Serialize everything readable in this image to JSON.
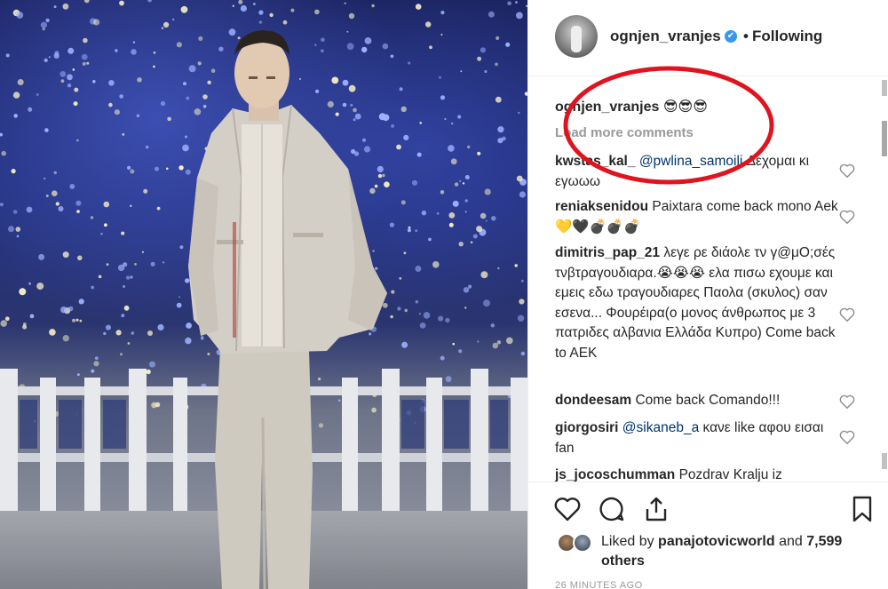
{
  "header": {
    "username": "ognjen_vranjes",
    "verified_badge": "✔",
    "separator": "•",
    "follow_status": "Following"
  },
  "caption": {
    "username": "ognjen_vranjes",
    "text": "😎😎😎"
  },
  "load_more": "Load more comments",
  "comments": [
    {
      "user": "kwstas_kal_",
      "mention": "@pwlina_samoili",
      "text": " Δεχομαι κι εγωωω"
    },
    {
      "user": "reniaksenidou",
      "mention": "",
      "text": "Paixtara come back mono Aek💛🖤💣💣💣"
    },
    {
      "user": "dimitris_pap_21",
      "mention": "",
      "text": "λεγε ρε διάολε τν γ@μΟ;σές τνβτραγουδιαρα.😭😭😭 ελα πισω εχουμε και εμεις εδω τραγουδιαρες Παολα (σκυλος) σαν εσενα... Φουρέιρα(ο μονος άνθρωπος με 3 πατριδες αλβανια Ελλάδα Κυπρο) Come back to AEK"
    },
    {
      "user": "dondeesam",
      "mention": "",
      "text": "Come back Comando!!!"
    },
    {
      "user": "giorgosiri",
      "mention": "@sikaneb_a",
      "text": " κανε like αφου εισαι fan"
    },
    {
      "user": "js_jocoschumman",
      "mention": "",
      "text": "Pozdrav Kralju iz"
    }
  ],
  "likes": {
    "prefix": "Liked by ",
    "user": "panajotovicworld",
    "middle": " and ",
    "count": "7,599 others"
  },
  "timestamp": "26 MINUTES AGO",
  "icons": [
    "heart-icon",
    "comment-icon",
    "share-icon",
    "bookmark-icon",
    "verified-icon"
  ],
  "colors": {
    "annotation": "#e0141e",
    "verified": "#3897f0",
    "mention": "#003569",
    "muted": "#999999"
  }
}
